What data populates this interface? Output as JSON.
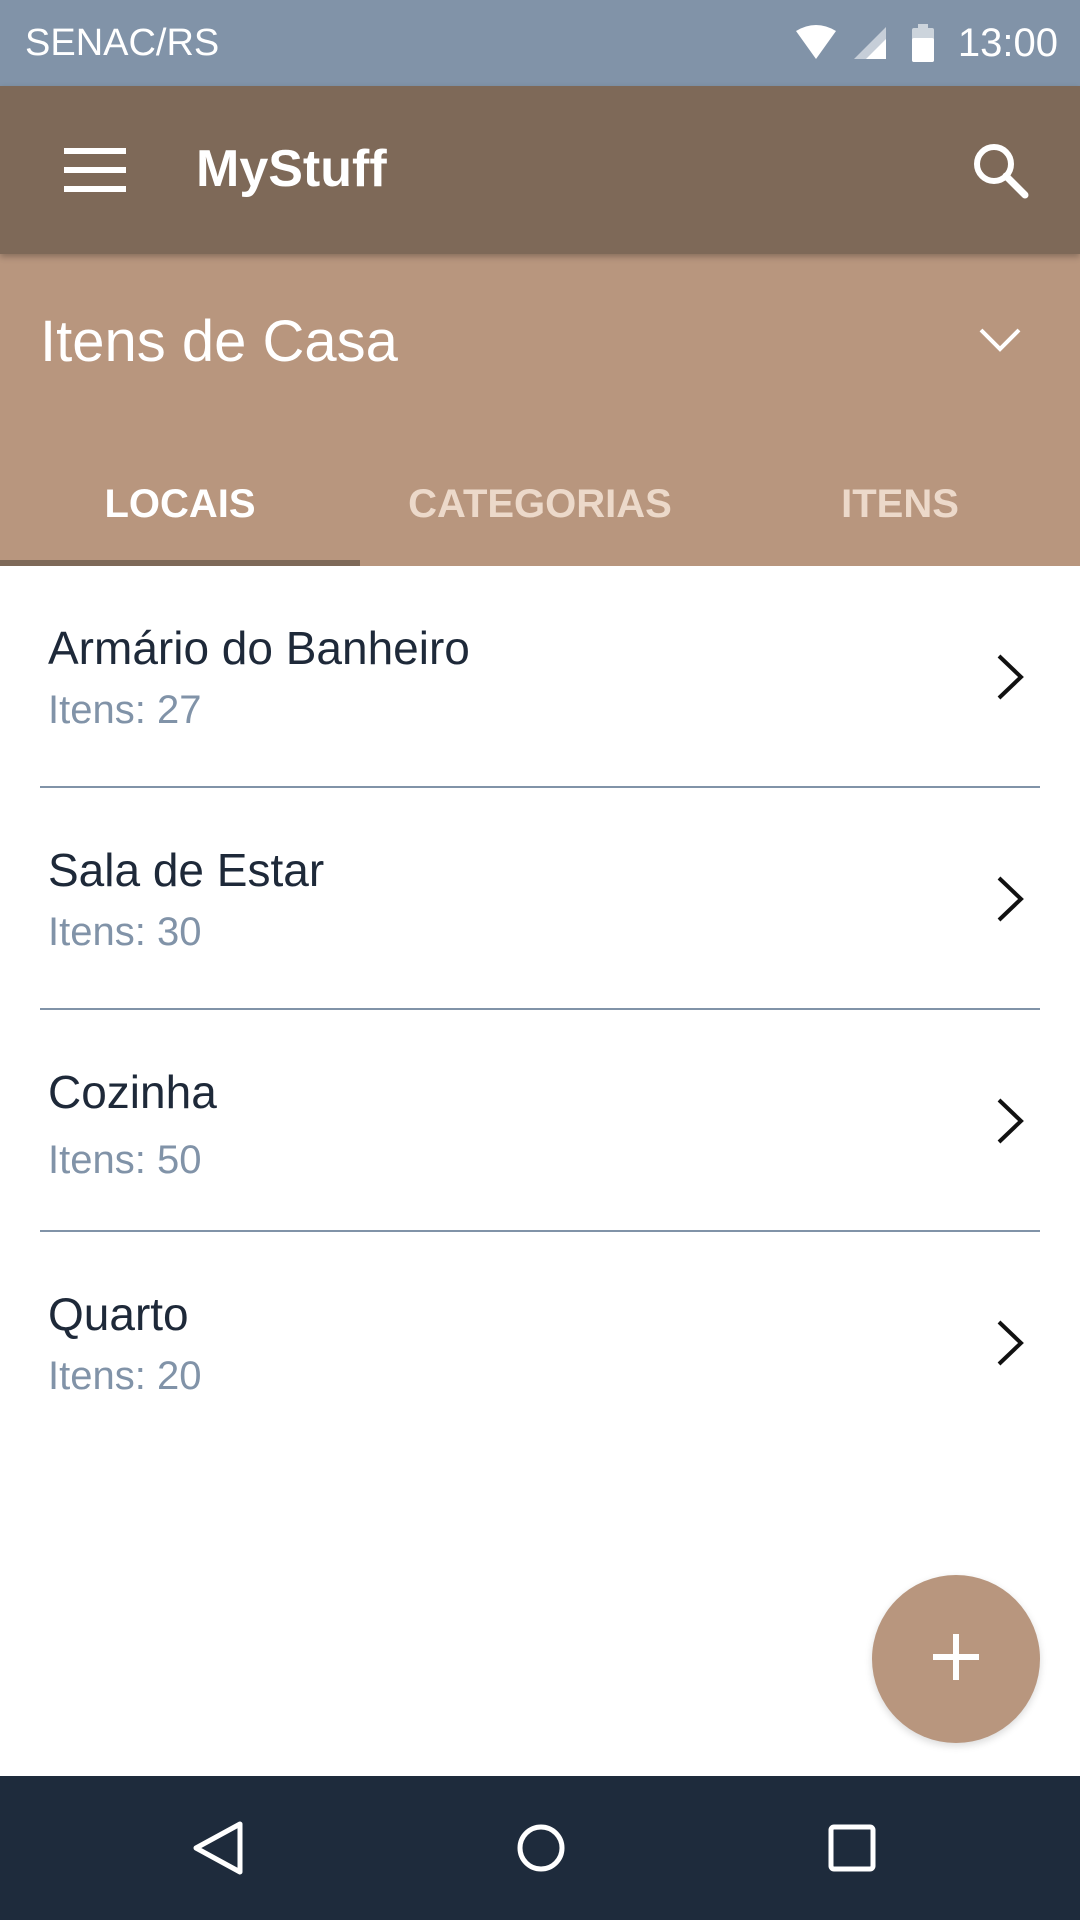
{
  "status_bar": {
    "carrier": "SENAC/RS",
    "time": "13:00",
    "icons": [
      "wifi-icon",
      "signal-icon",
      "battery-icon"
    ]
  },
  "app_bar": {
    "title": "MyStuff",
    "icons": [
      "menu-icon",
      "search-icon"
    ]
  },
  "header": {
    "collection": "Itens de Casa",
    "dropdown_icon": "chevron-down-icon"
  },
  "tabs": [
    {
      "label": "LOCAIS",
      "active": true
    },
    {
      "label": "CATEGORIAS",
      "active": false
    },
    {
      "label": "ITENS",
      "active": false
    }
  ],
  "locations": [
    {
      "name": "Armário do Banheiro",
      "count": "Itens: 27"
    },
    {
      "name": "Sala de Estar",
      "count": "Itens: 30"
    },
    {
      "name": "Cozinha",
      "count": "Itens: 50"
    },
    {
      "name": "Quarto",
      "count": "Itens: 20"
    }
  ],
  "fab": {
    "icon": "plus-icon"
  },
  "nav_bar": {
    "icons": [
      "back-icon",
      "home-icon",
      "recents-icon"
    ]
  },
  "colors": {
    "status_bar": "#8193a8",
    "app_bar": "#7e6958",
    "header": "#b8967e",
    "nav_bar": "#1e2b3c",
    "text_primary": "#1e2939",
    "text_secondary": "#8193a8"
  }
}
